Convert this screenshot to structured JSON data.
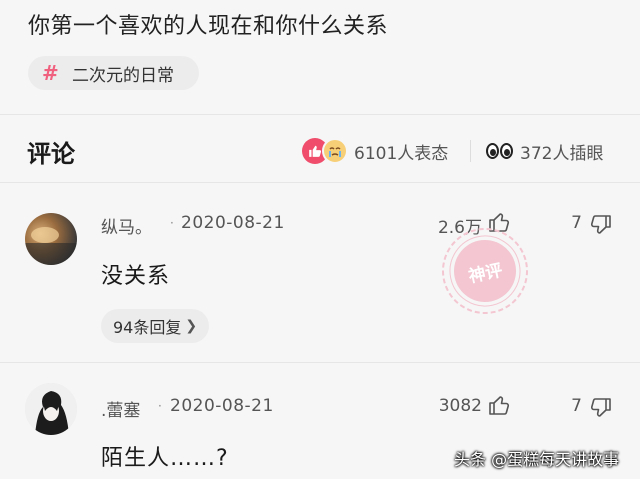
{
  "post": {
    "title": "你第一个喜欢的人现在和你什么关系",
    "tag": {
      "icon": "hash-icon",
      "label": "二次元的日常"
    }
  },
  "comments_header": {
    "title": "评论",
    "reactions": [
      {
        "label": "6101人表态",
        "icons": [
          "thumbs-up-icon",
          "crying-face-icon"
        ]
      },
      {
        "label": "372人插眼",
        "icons": [
          "eyes-icon"
        ]
      }
    ]
  },
  "comments": [
    {
      "username": "纵马。",
      "dot": "·",
      "date": "2020-08-21",
      "likes": "2.6万",
      "dislikes": "7",
      "text": "没关系",
      "replies": "94条回复",
      "badge": "神评"
    },
    {
      "username": ".蕾塞",
      "dot": "·",
      "date": "2020-08-21",
      "likes": "3082",
      "dislikes": "7",
      "text": "陌生人……?"
    }
  ],
  "watermark": "头条 @蛋糕每天讲故事",
  "colors": {
    "accent": "#ef4d6b",
    "badge": "#f3c6d1",
    "background": "#f6f6f6"
  }
}
